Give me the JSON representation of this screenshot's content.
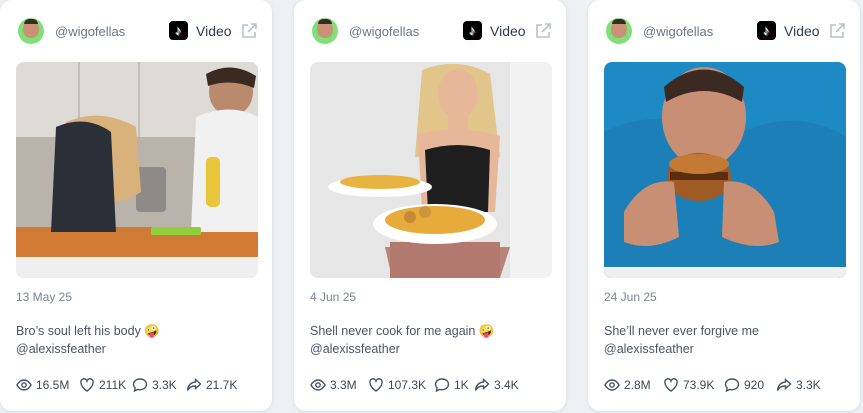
{
  "posts": [
    {
      "handle": "@wigofellas",
      "platform_label": "Video",
      "date": "13 May 25",
      "caption_line1": "Bro’s soul left his body 🤪",
      "caption_line2": "@alexissfeather",
      "stats": {
        "views": "16.5M",
        "likes": "211K",
        "comments": "3.3K",
        "shares": "21.7K"
      }
    },
    {
      "handle": "@wigofellas",
      "platform_label": "Video",
      "date": "4 Jun 25",
      "caption_line1": "Shell never cook for me again 🤪",
      "caption_line2": "@alexissfeather",
      "stats": {
        "views": "3.3M",
        "likes": "107.3K",
        "comments": "1K",
        "shares": "3.4K"
      }
    },
    {
      "handle": "@wigofellas",
      "platform_label": "Video",
      "date": "24 Jun 25",
      "caption_line1": "She’ll never ever forgive me",
      "caption_line2": "@alexissfeather",
      "stats": {
        "views": "2.8M",
        "likes": "73.9K",
        "comments": "920",
        "shares": "3.3K"
      }
    }
  ],
  "icons": {
    "platform": "tiktok-icon",
    "external": "external-link-icon",
    "views": "eye-icon",
    "likes": "heart-icon",
    "comments": "comment-icon",
    "shares": "share-icon"
  },
  "colors": {
    "background": "#eef0f4",
    "card": "#ffffff",
    "avatar_bg": "#7fe07a",
    "muted_text": "#7a8496"
  }
}
